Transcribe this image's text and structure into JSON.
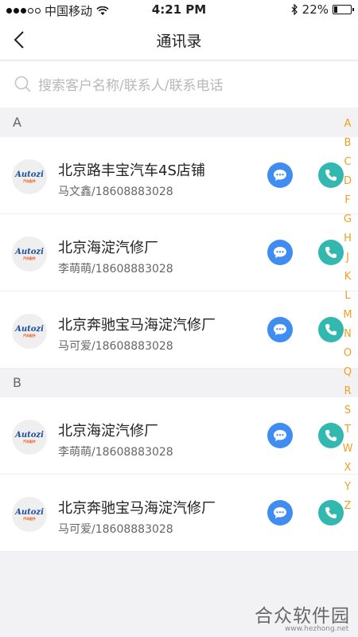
{
  "status_bar": {
    "carrier": "中国移动",
    "time": "4:21 PM",
    "battery": "22%",
    "battery_level": 0.22,
    "icons": [
      "signal-icon",
      "wifi-icon",
      "bluetooth-icon",
      "battery-icon"
    ]
  },
  "nav": {
    "title": "通讯录",
    "back_icon": "chevron-left-icon"
  },
  "search": {
    "placeholder": "搜索客户名称/联系人/联系电话",
    "icon": "search-icon"
  },
  "sections": [
    {
      "letter": "A",
      "items": [
        {
          "name": "北京路丰宝汽车4S店铺",
          "contact": "马文鑫/18608883028"
        },
        {
          "name": "北京海淀汽修厂",
          "contact": "李萌萌/18608883028"
        },
        {
          "name": "北京奔驰宝马海淀汽修厂",
          "contact": "马可爱/18608883028"
        }
      ]
    },
    {
      "letter": "B",
      "items": [
        {
          "name": "北京海淀汽修厂",
          "contact": "李萌萌/18608883028"
        },
        {
          "name": "北京奔驰宝马海淀汽修厂",
          "contact": "马可爱/18608883028"
        }
      ]
    }
  ],
  "avatar_logo": {
    "text": "Autozi",
    "sub": "汽车配件"
  },
  "alpha_index": [
    "A",
    "B",
    "C",
    "D",
    "F",
    "G",
    "H",
    "J",
    "K",
    "L",
    "M",
    "N",
    "O",
    "Q",
    "R",
    "S",
    "T",
    "W",
    "X",
    "Y",
    "Z"
  ],
  "colors": {
    "message_button": "#3f8df0",
    "call_button": "#33b8b0",
    "index_letters": "#f0a020",
    "background": "#f2f2f4"
  },
  "watermark": {
    "main": "合众软件园",
    "url": "www.hezhong.net"
  }
}
